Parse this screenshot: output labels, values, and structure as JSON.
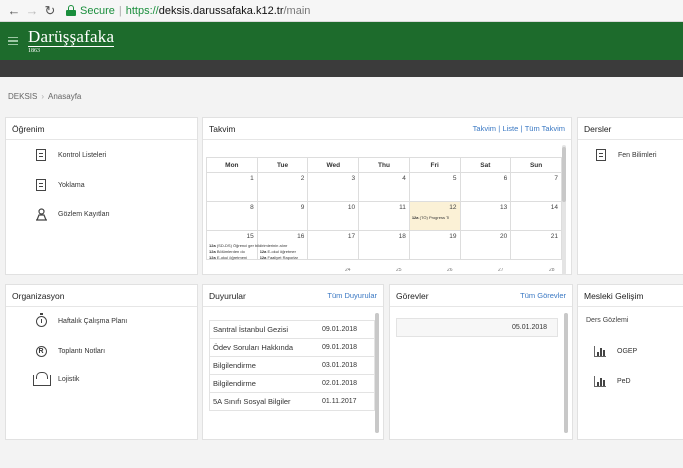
{
  "browser": {
    "secure_label": "Secure",
    "url_scheme": "https://",
    "url_host": "deksis.darussafaka.k12.tr",
    "url_path": "/main"
  },
  "header": {
    "logo_name": "Darüşşafaka",
    "logo_year": "1863",
    "brand_color": "#1d6b2c"
  },
  "breadcrumb": {
    "root": "DEKSIS",
    "current": "Anasayfa"
  },
  "ogrenim": {
    "title": "Öğrenim",
    "items": [
      {
        "label": "Kontrol Listeleri",
        "icon": "checklist-icon"
      },
      {
        "label": "Yoklama",
        "icon": "attendance-icon"
      },
      {
        "label": "Gözlem Kayıtları",
        "icon": "observation-icon"
      }
    ]
  },
  "takvim": {
    "title": "Takvim",
    "links": [
      "Takvim",
      "Liste",
      "Tüm Takvim"
    ],
    "link_sep": "|",
    "days": [
      "Mon",
      "Tue",
      "Wed",
      "Thu",
      "Fri",
      "Sat",
      "Sun"
    ],
    "weeks": [
      [
        "",
        "",
        "",
        "",
        "",
        "",
        ""
      ],
      [
        "1",
        "2",
        "3",
        "4",
        "5",
        "6",
        "7"
      ],
      [
        "8",
        "9",
        "10",
        "11",
        "12",
        "13",
        "14"
      ],
      [
        "15",
        "16",
        "17",
        "18",
        "19",
        "20",
        "21"
      ],
      [
        "22",
        "23",
        "24",
        "25",
        "26",
        "27",
        "28"
      ]
    ],
    "events": {
      "fri12": {
        "time": "12a",
        "text": "(TÖ) Progress Ti"
      },
      "mon15a": {
        "time": "12a",
        "text": "(SD-DS) Öğrenci ger bildirimlerinin alınr"
      },
      "mon15b": {
        "time": "12a",
        "text": "Bölümlerden do"
      },
      "tue16b": {
        "time": "12a",
        "text": "E-okul öğretmer"
      },
      "mon15c": {
        "time": "12a",
        "text": "E-okul öğretmeni"
      },
      "tue16c": {
        "time": "12a",
        "text": "Faaliyet Raporlar"
      }
    },
    "bottom_row": [
      "24",
      "25",
      "26",
      "27",
      "28"
    ]
  },
  "dersler": {
    "title": "Dersler",
    "items": [
      {
        "label": "Fen Bilimleri",
        "icon": "book-icon"
      }
    ]
  },
  "organizasyon": {
    "title": "Organizasyon",
    "items": [
      {
        "label": "Haftalık Çalışma Planı",
        "icon": "stopwatch-icon"
      },
      {
        "label": "Toplantı Notları",
        "icon": "meeting-notes-icon"
      },
      {
        "label": "Lojistik",
        "icon": "building-icon"
      }
    ]
  },
  "duyurular": {
    "title": "Duyurular",
    "link": "Tüm Duyurular",
    "rows": [
      {
        "title": "Santral İstanbul Gezisi",
        "date": "09.01.2018"
      },
      {
        "title": "Ödev Soruları Hakkında",
        "date": "09.01.2018"
      },
      {
        "title": "Bilgilendirme",
        "date": "03.01.2018"
      },
      {
        "title": "Bilgilendirme",
        "date": "02.01.2018"
      },
      {
        "title": "5A Sınıfı Sosyal Bilgiler",
        "date": "01.11.2017"
      }
    ]
  },
  "gorevler": {
    "title": "Görevler",
    "link": "Tüm Görevler",
    "rows": [
      {
        "date": "05.01.2018"
      }
    ]
  },
  "mesleki": {
    "title": "Mesleki Gelişim",
    "subtitle": "Ders Gözlemi",
    "items": [
      {
        "label": "OGEP",
        "icon": "bar-chart-icon"
      },
      {
        "label": "PeD",
        "icon": "bar-chart-icon"
      }
    ]
  }
}
